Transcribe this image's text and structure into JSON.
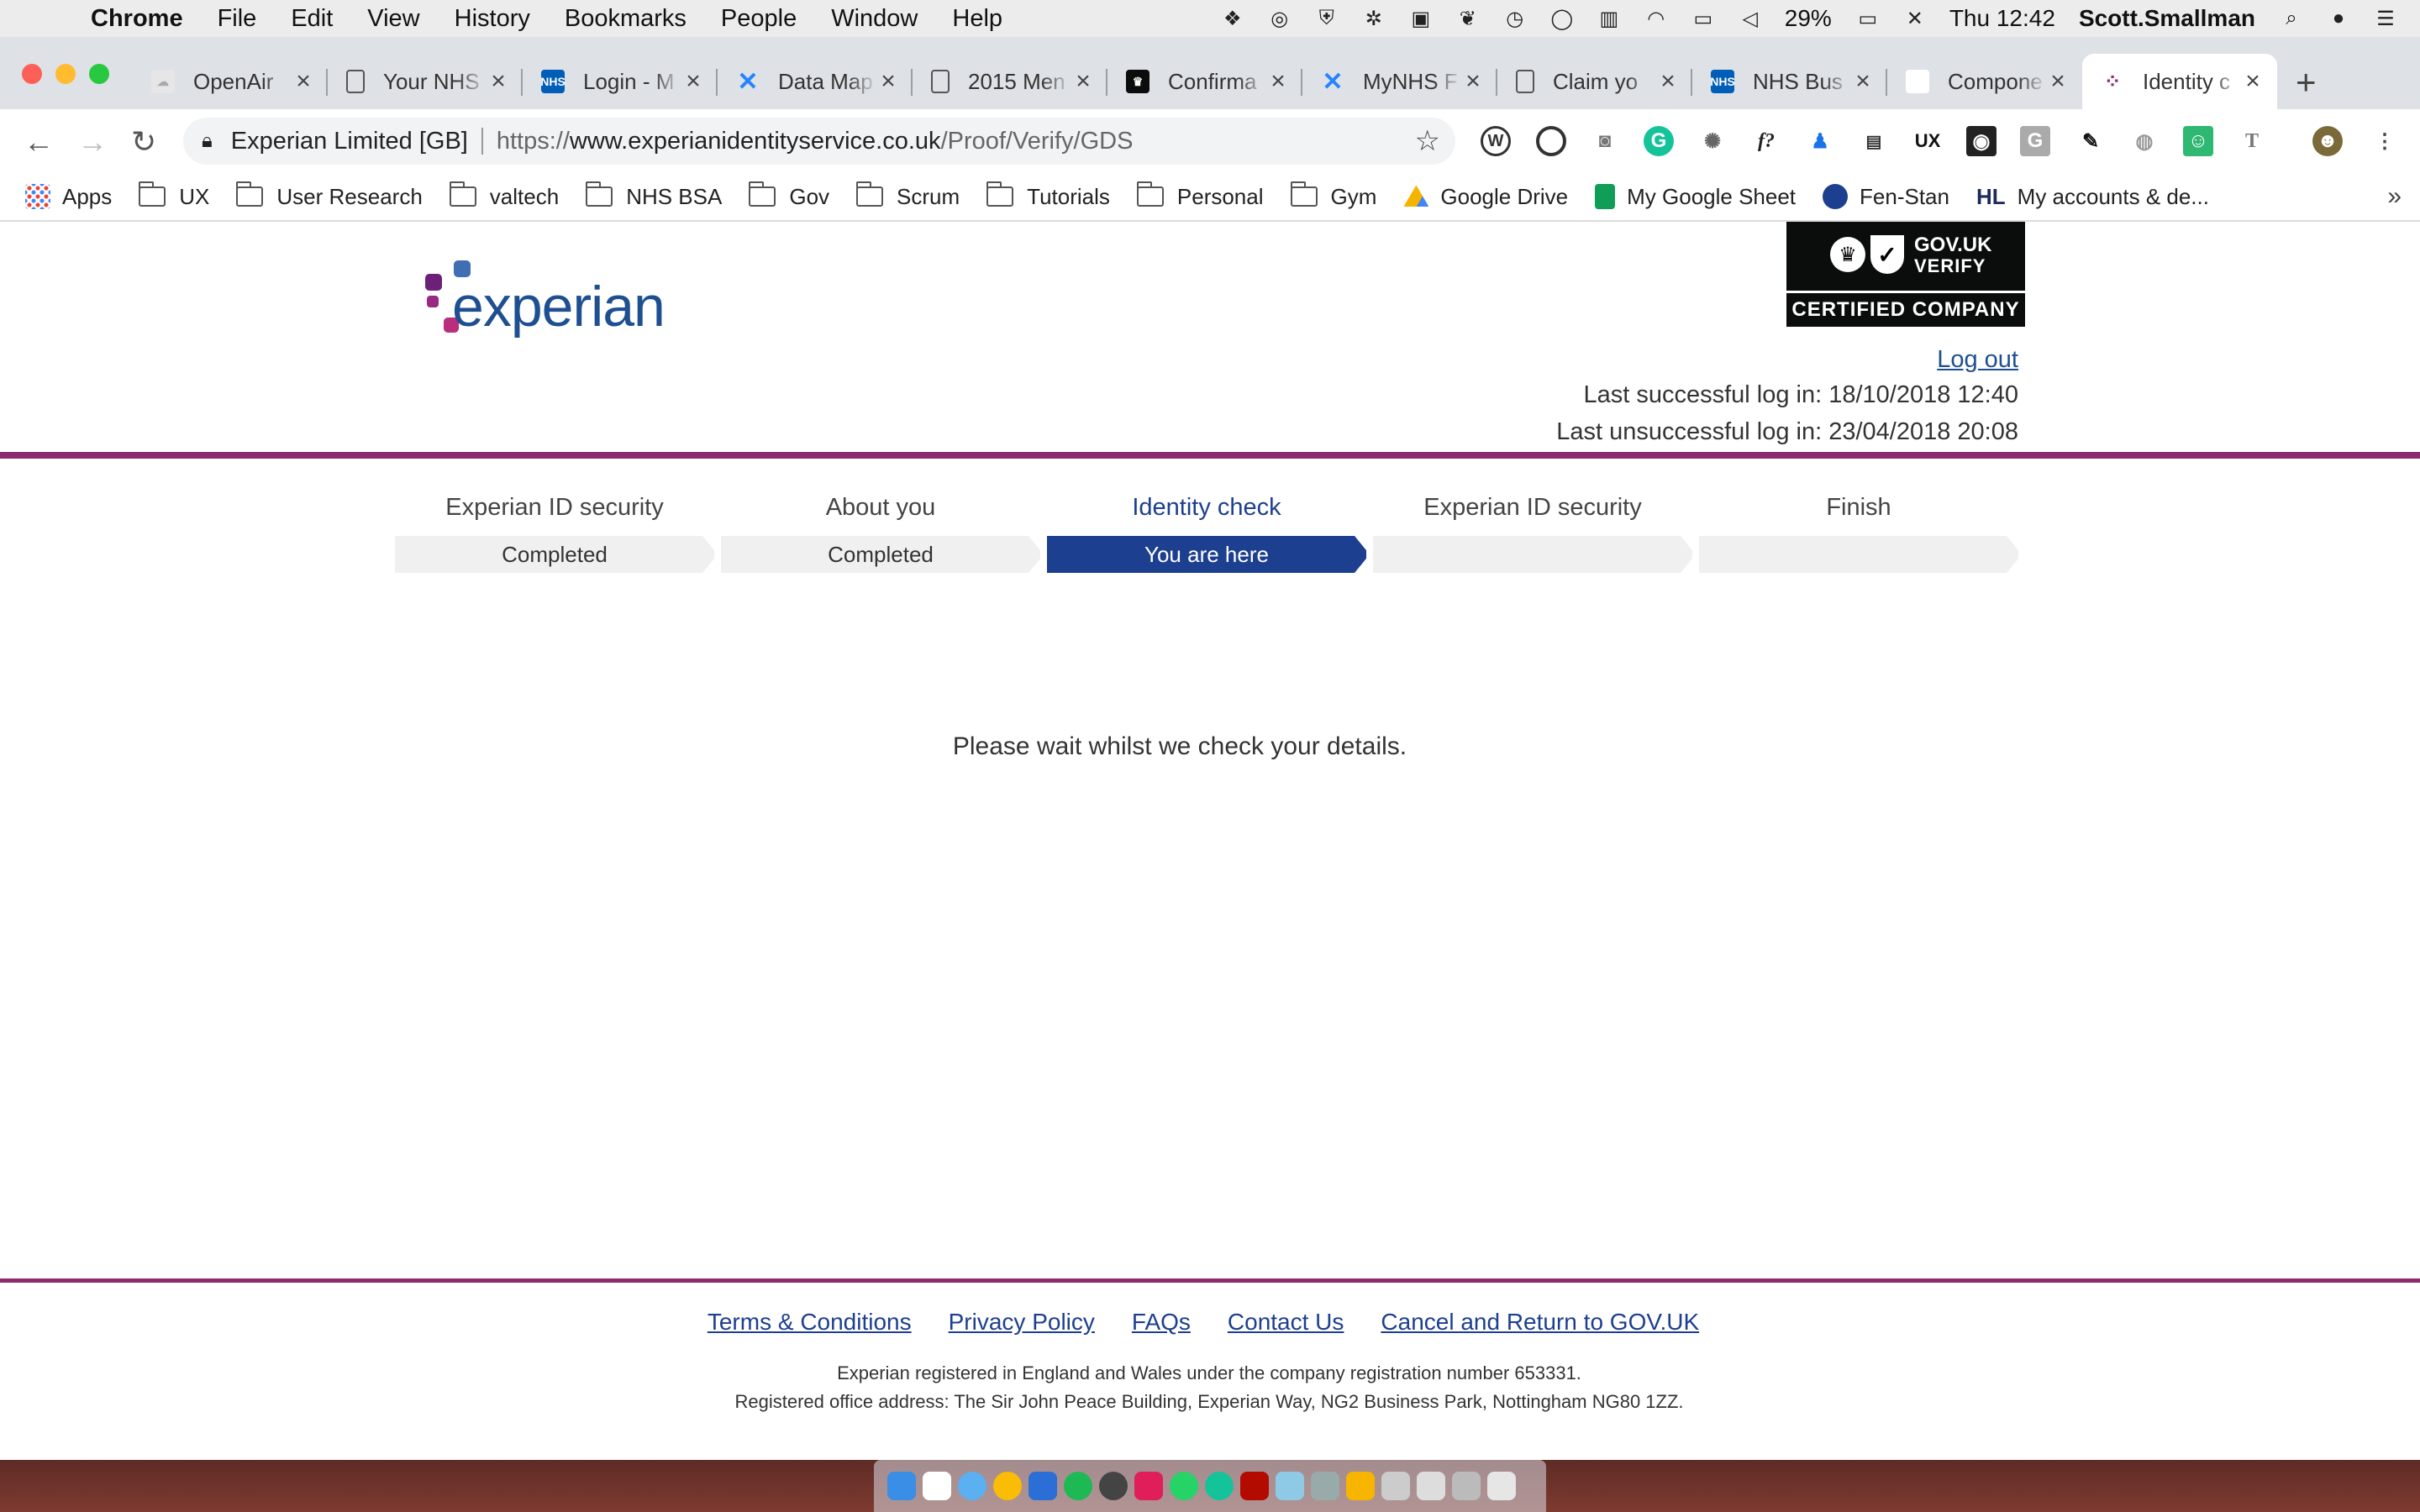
{
  "menubar": {
    "app": "Chrome",
    "menus": [
      "File",
      "Edit",
      "View",
      "History",
      "Bookmarks",
      "People",
      "Window",
      "Help"
    ],
    "battery": "29%",
    "clock": "Thu 12:42",
    "user": "Scott.Smallman"
  },
  "tabs": [
    {
      "label": "OpenAir",
      "icon": "cloud-icon",
      "color": "#bbbbbb"
    },
    {
      "label": "Your NHS",
      "icon": "document-icon",
      "color": "#ffffff"
    },
    {
      "label": "Login - M",
      "icon": "nhs-icon",
      "color": "#005eb8"
    },
    {
      "label": "Data Map",
      "icon": "confluence-icon",
      "color": "#2684ff"
    },
    {
      "label": "2015 Men",
      "icon": "document-icon",
      "color": "#ffffff"
    },
    {
      "label": "Confirma",
      "icon": "crown-icon",
      "color": "#0b0c0c"
    },
    {
      "label": "MyNHS F",
      "icon": "confluence-icon",
      "color": "#2684ff"
    },
    {
      "label": "Claim yo",
      "icon": "document-icon",
      "color": "#ffffff"
    },
    {
      "label": "NHS Bus",
      "icon": "nhsbsa-icon",
      "color": "#005eb8"
    },
    {
      "label": "Compone",
      "icon": "blank-icon",
      "color": "#ffffff"
    },
    {
      "label": "Identity c",
      "icon": "experian-icon",
      "color": "#ffffff"
    }
  ],
  "omnibox": {
    "site": "Experian Limited [GB]",
    "protocol": "https://",
    "domain": "www.experianidentityservice.co.uk",
    "path": "/Proof/Verify/GDS"
  },
  "bookmarks": [
    {
      "label": "Apps",
      "type": "apps"
    },
    {
      "label": "UX",
      "type": "folder"
    },
    {
      "label": "User Research",
      "type": "folder"
    },
    {
      "label": "valtech",
      "type": "folder"
    },
    {
      "label": "NHS BSA",
      "type": "folder"
    },
    {
      "label": "Gov",
      "type": "folder"
    },
    {
      "label": "Scrum",
      "type": "folder"
    },
    {
      "label": "Tutorials",
      "type": "folder"
    },
    {
      "label": "Personal",
      "type": "folder"
    },
    {
      "label": "Gym",
      "type": "folder"
    },
    {
      "label": "Google Drive",
      "type": "drive"
    },
    {
      "label": "My Google Sheet",
      "type": "sheet"
    },
    {
      "label": "Fen-Stan",
      "type": "rail"
    },
    {
      "label": "My accounts & de...",
      "type": "hl"
    }
  ],
  "header": {
    "logo_text": "experian",
    "badge_line1": "GOV.UK",
    "badge_line2": "VERIFY",
    "badge_line3": "CERTIFIED COMPANY",
    "logout": "Log out",
    "last_success": "Last successful log in: 18/10/2018 12:40",
    "last_unsuccess": "Last unsuccessful log in: 23/04/2018 20:08"
  },
  "steps": [
    {
      "label": "Experian ID security",
      "status": "Completed"
    },
    {
      "label": "About you",
      "status": "Completed"
    },
    {
      "label": "Identity check",
      "status": "You are here"
    },
    {
      "label": "Experian ID security",
      "status": ""
    },
    {
      "label": "Finish",
      "status": ""
    }
  ],
  "main": {
    "message": "Please wait whilst we check your details."
  },
  "footer": {
    "links": [
      "Terms & Conditions",
      "Privacy Policy",
      "FAQs",
      "Contact Us",
      "Cancel and Return to GOV.UK"
    ],
    "line1": "Experian registered in England and Wales under the company registration number 653331.",
    "line2": "Registered office address: The Sir John Peace Building, Experian Way, NG2 Business Park, Nottingham NG80 1ZZ."
  },
  "colors": {
    "experian_blue": "#1d4f91",
    "experian_purple": "#8c2a6f",
    "progress_current": "#1d3f8f"
  }
}
